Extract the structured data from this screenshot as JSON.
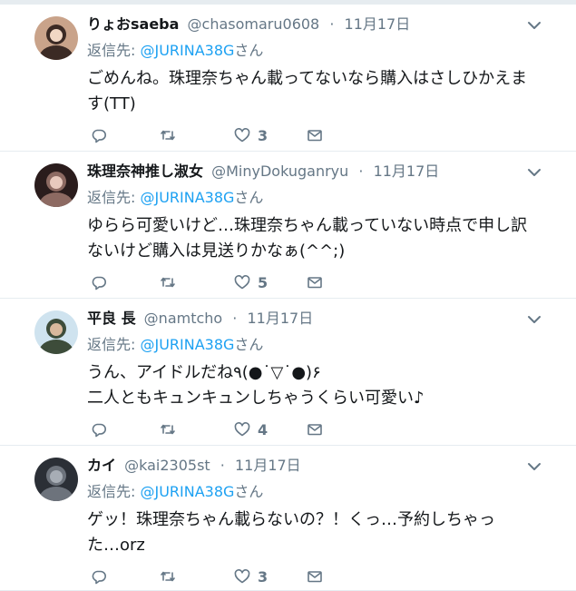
{
  "tweets": [
    {
      "name": "りょおsaeba",
      "handle": "@chasomaru0608",
      "separator": "·",
      "time": "11月17日",
      "reply_prefix": "返信先: ",
      "reply_mention": "@JURINA38G",
      "reply_suffix": "さん",
      "text_lines": [
        "ごめんね。珠理奈ちゃん載ってないなら購入はさしひかえま",
        "す(TT)"
      ],
      "like_count": "3",
      "avatar_colors": [
        "#c9a38a",
        "#3b2a24",
        "#f1d7c4"
      ]
    },
    {
      "name": "珠理奈神推し淑女",
      "handle": "@MinyDokuganryu",
      "separator": "·",
      "time": "11月17日",
      "reply_prefix": "返信先: ",
      "reply_mention": "@JURINA38G",
      "reply_suffix": "さん",
      "text_lines": [
        "ゆらら可愛いけど…珠理奈ちゃん載っていない時点で申し訳",
        "ないけど購入は見送りかなぁ(^^;)"
      ],
      "like_count": "5",
      "avatar_colors": [
        "#2a1c1c",
        "#8d6a62",
        "#e8c9bd"
      ]
    },
    {
      "name": "平良 長",
      "handle": "@namtcho",
      "separator": "·",
      "time": "11月17日",
      "reply_prefix": "返信先: ",
      "reply_mention": "@JURINA38G",
      "reply_suffix": "さん",
      "text_lines": [
        "うん、アイドルだね٩(●˙▽˙●)۶",
        "二人ともキュンキュンしちゃうくらい可愛い♪"
      ],
      "like_count": "4",
      "avatar_colors": [
        "#cfe3ef",
        "#3d4c3a",
        "#d9b89c"
      ]
    },
    {
      "name": "カイ",
      "handle": "@kai2305st",
      "separator": "·",
      "time": "11月17日",
      "reply_prefix": "返信先: ",
      "reply_mention": "@JURINA38G",
      "reply_suffix": "さん",
      "text_lines": [
        "ゲッ！珠理奈ちゃん載らないの？！くっ…予約しちゃっ",
        "た…orz"
      ],
      "like_count": "3",
      "avatar_colors": [
        "#2b2f36",
        "#6d737c",
        "#a7adb5"
      ]
    }
  ],
  "colors": {
    "link": "#1da1f2",
    "secondary_text": "#657786",
    "primary_text": "#14171a",
    "divider": "#e6ecf0"
  },
  "icons": {
    "reply": "reply-icon",
    "retweet": "retweet-icon",
    "like": "heart-icon",
    "dm": "envelope-icon",
    "caret": "chevron-down-icon"
  }
}
